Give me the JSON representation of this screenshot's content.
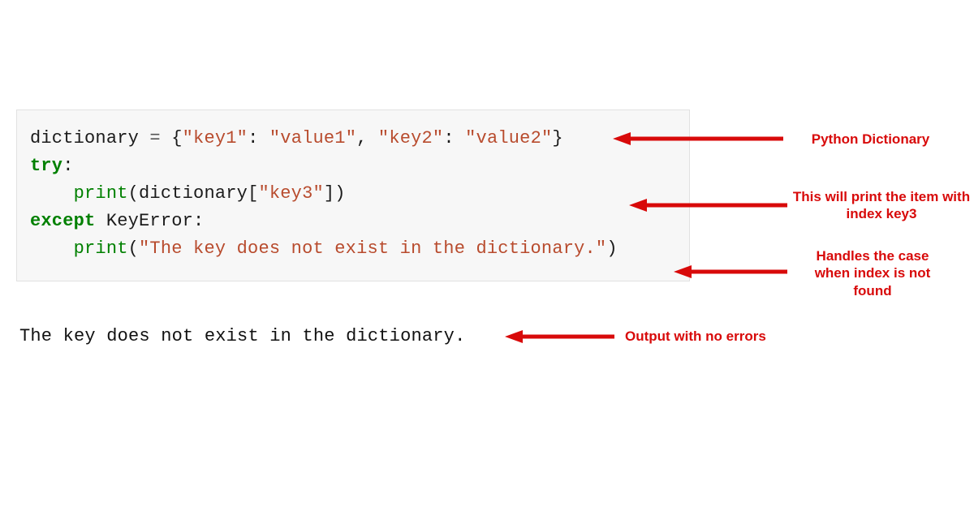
{
  "code": {
    "l1": {
      "var": "dictionary",
      "eq": " = ",
      "ob": "{",
      "k1": "\"key1\"",
      "c1": ": ",
      "v1": "\"value1\"",
      "cm": ", ",
      "k2": "\"key2\"",
      "c2": ": ",
      "v2": "\"value2\"",
      "cb": "}"
    },
    "blank1": "",
    "l2": {
      "kw": "try",
      "col": ":"
    },
    "l3": {
      "indent": "    ",
      "fn": "print",
      "op": "(",
      "obj": "dictionary",
      "ob": "[",
      "key": "\"key3\"",
      "cb": "]",
      "cp": ")"
    },
    "l4": {
      "kw": "except",
      "sp": " ",
      "exc": "KeyError",
      "col": ":"
    },
    "l5": {
      "indent": "    ",
      "fn": "print",
      "op": "(",
      "msg": "\"The key does not exist in the dictionary.\"",
      "cp": ")"
    }
  },
  "output": "The key does not exist in the dictionary.",
  "annotations": {
    "a1": "Python Dictionary",
    "a2": "This will print the item with index key3",
    "a3": "Handles the case when index is not found",
    "a4": "Output with no errors"
  }
}
